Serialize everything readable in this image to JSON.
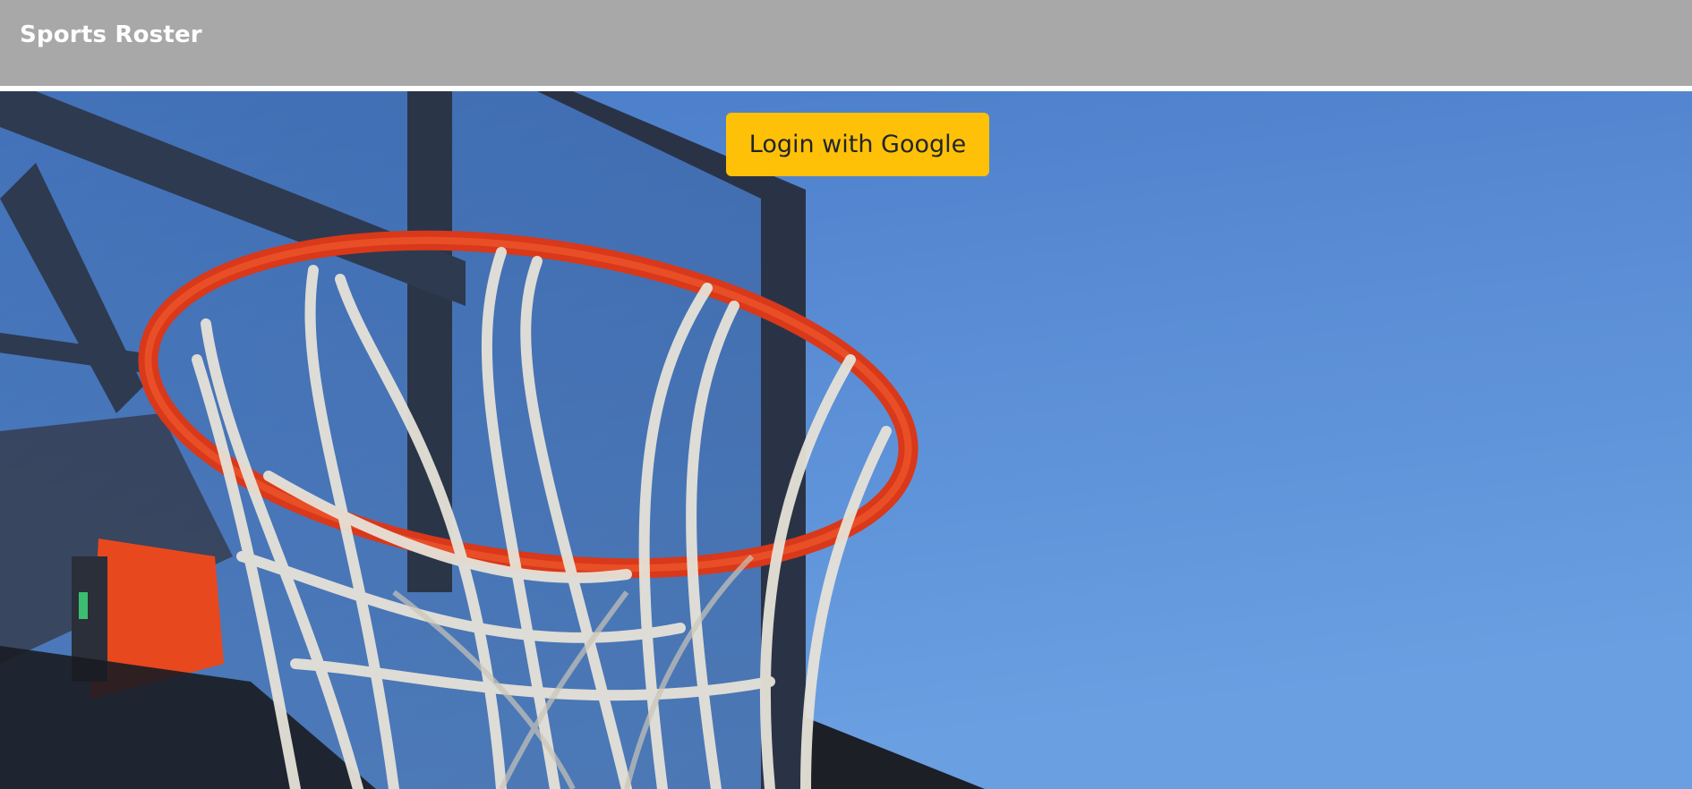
{
  "navbar": {
    "brand": "Sports Roster"
  },
  "hero": {
    "image": "basketball-hoop-photo",
    "sky_color": "#5a8fd6",
    "rim_color": "#e8401c",
    "net_color": "#e4e0d6"
  },
  "login": {
    "label": "Login with Google",
    "color": "#ffc107"
  }
}
